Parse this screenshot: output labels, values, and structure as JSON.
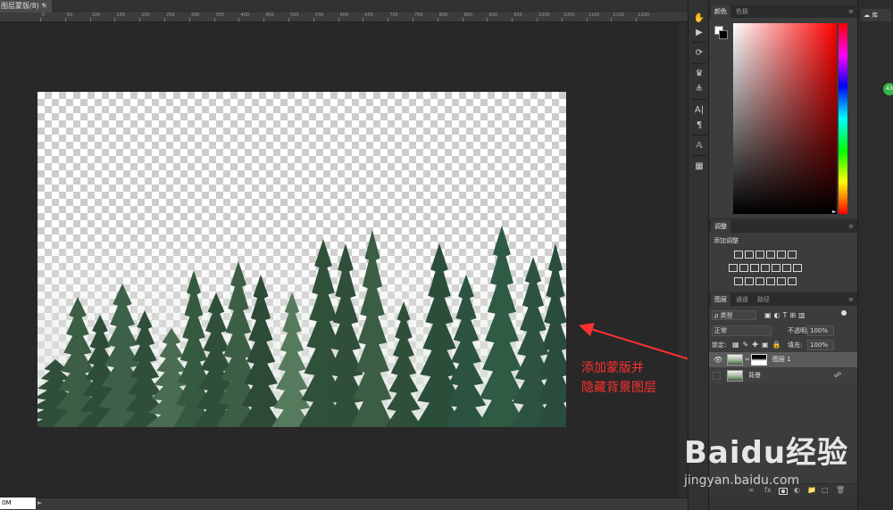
{
  "document": {
    "tab_title": "图层蒙版/8) *",
    "close_glyph": "×",
    "zoom": "0M"
  },
  "ruler": {
    "ticks": [
      "0",
      "50",
      "100",
      "150",
      "200",
      "250",
      "300",
      "350",
      "400",
      "450",
      "500",
      "550",
      "600",
      "650",
      "700",
      "750",
      "800",
      "850",
      "900",
      "950",
      "1000",
      "1050",
      "1100",
      "1150",
      "1200"
    ]
  },
  "annotation": {
    "line1": "添加蒙版并",
    "line2": "隐藏背景图层"
  },
  "tools": [
    "move-icon",
    "play-icon",
    "3d-rotate-icon",
    "puppet-icon",
    "adjust-icon",
    "text-icon",
    "paragraph-icon",
    "glyph-icon",
    "layer-comp-icon"
  ],
  "color_panel": {
    "tabs": [
      "颜色",
      "色板"
    ],
    "foreground": "#ffffff",
    "background": "#000000"
  },
  "adjustments_panel": {
    "tab": "调整",
    "title": "添加调整"
  },
  "layers_panel": {
    "tabs": [
      "图层",
      "通道",
      "路径"
    ],
    "filter_label": "ρ 类型",
    "blend_mode": "正常",
    "opacity_label": "不透明度:",
    "opacity_value": "100%",
    "lock_label": "锁定:",
    "fill_label": "填充:",
    "fill_value": "100%",
    "layers": [
      {
        "name": "图层 1",
        "visible": true,
        "has_mask": true,
        "locked": false
      },
      {
        "name": "背景",
        "visible": false,
        "has_mask": false,
        "locked": true
      }
    ]
  },
  "library": {
    "label": "库",
    "badge": "43"
  },
  "watermark": {
    "main": "Baidu经验",
    "sub": "jingyan.baidu.com"
  },
  "colors": {
    "annotation": "#ff3030",
    "panel": "#3c3c3c",
    "workspace": "#282828"
  }
}
